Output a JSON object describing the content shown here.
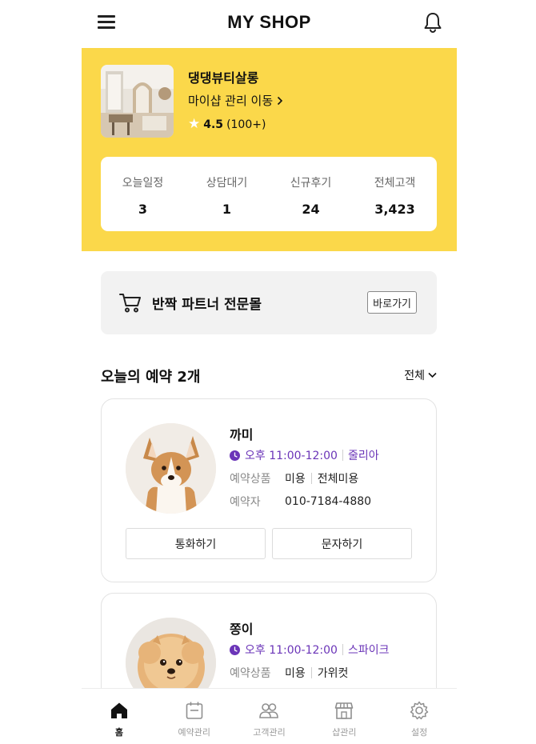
{
  "header": {
    "title": "MY SHOP"
  },
  "store": {
    "name": "댕댕뷰티살롱",
    "link_label": "마이샵 관리 이동",
    "rating": "4.5",
    "review_count": "(100+)"
  },
  "stats": [
    {
      "label": "오늘일정",
      "value": "3"
    },
    {
      "label": "상담대기",
      "value": "1"
    },
    {
      "label": "신규후기",
      "value": "24"
    },
    {
      "label": "전체고객",
      "value": "3,423"
    }
  ],
  "partner": {
    "title": "반짝 파트너 전문몰",
    "button_label": "바로가기"
  },
  "reservations_section": {
    "heading": "오늘의 예약 2개",
    "filter_label": "전체"
  },
  "reservations": [
    {
      "pet_name": "까미",
      "time": "오후 11:00-12:00",
      "staff": "줄리아",
      "product_label": "예약상품",
      "product_type": "미용",
      "product_name": "전체미용",
      "booker_label": "예약자",
      "phone": "010-7184-4880",
      "call_label": "통화하기",
      "sms_label": "문자하기"
    },
    {
      "pet_name": "쫑이",
      "time": "오후 11:00-12:00",
      "staff": "스파이크",
      "product_label": "예약상품",
      "product_type": "미용",
      "product_name": "가위컷"
    }
  ],
  "bottom_nav": [
    {
      "label": "홈",
      "icon": "home-icon",
      "active": true
    },
    {
      "label": "예약관리",
      "icon": "calendar-icon",
      "active": false
    },
    {
      "label": "고객관리",
      "icon": "users-icon",
      "active": false
    },
    {
      "label": "샵관리",
      "icon": "store-icon",
      "active": false
    },
    {
      "label": "설정",
      "icon": "gear-icon",
      "active": false
    }
  ],
  "colors": {
    "brand_yellow": "#fbd84a",
    "accent_purple": "#6b35b8",
    "panel_gray": "#f2f2f2"
  }
}
